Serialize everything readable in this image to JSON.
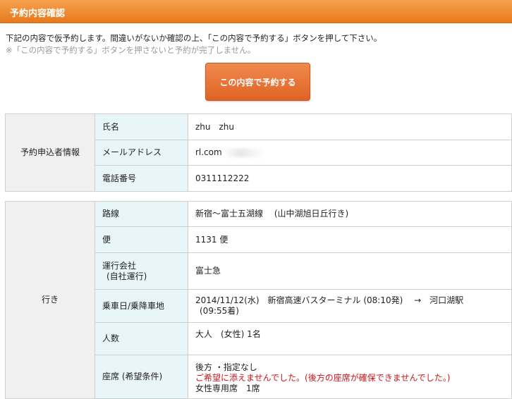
{
  "header": {
    "title": "予約内容確認"
  },
  "notes": {
    "line1": "下記の内容で仮予約します。間違いがないか確認の上、「この内容で予約する」ボタンを押して下さい。",
    "line2": "※「この内容で予約する」ボタンを押さないと予約が完了しません。"
  },
  "confirm_button": {
    "label": "この内容で予約する"
  },
  "applicant": {
    "group_label": "予約申込者情報",
    "name_label": "氏名",
    "name_value": "zhu　zhu",
    "email_label": "メールアドレス",
    "email_value": "rl.com",
    "phone_label": "電話番号",
    "phone_value": "0311112222"
  },
  "outbound": {
    "group_label": "行き",
    "route_label": "路線",
    "route_value": "新宿〜富士五湖線　 (山中湖旭日丘行き)",
    "service_label": "便",
    "service_value": "1131 便",
    "operator_label_1": "運行会社",
    "operator_label_2": "(自社運行)",
    "operator_value": "富士急",
    "date_label": "乗車日/乗降車地",
    "date_value_1": "2014/11/12(水)　新宿高速バスターミナル (08:10発)　 →　河口湖駅",
    "date_value_2": "(09:55着)",
    "passengers_label": "人数",
    "passengers_value": "大人　(女性) 1名",
    "seat_label": "座席 (希望条件)",
    "seat_value_1": "後方 ・指定なし",
    "seat_value_2": "ご希望に添えませんでした。(後方の座席が確保できませんでした。)",
    "seat_value_3": "女性専用席　1席"
  },
  "colors": {
    "header_orange": "#ef8d32",
    "button_orange": "#e56a2a",
    "label_bg": "#e9f6f9",
    "group_bg": "#f0f0f0",
    "warning_red": "#d0141a"
  }
}
